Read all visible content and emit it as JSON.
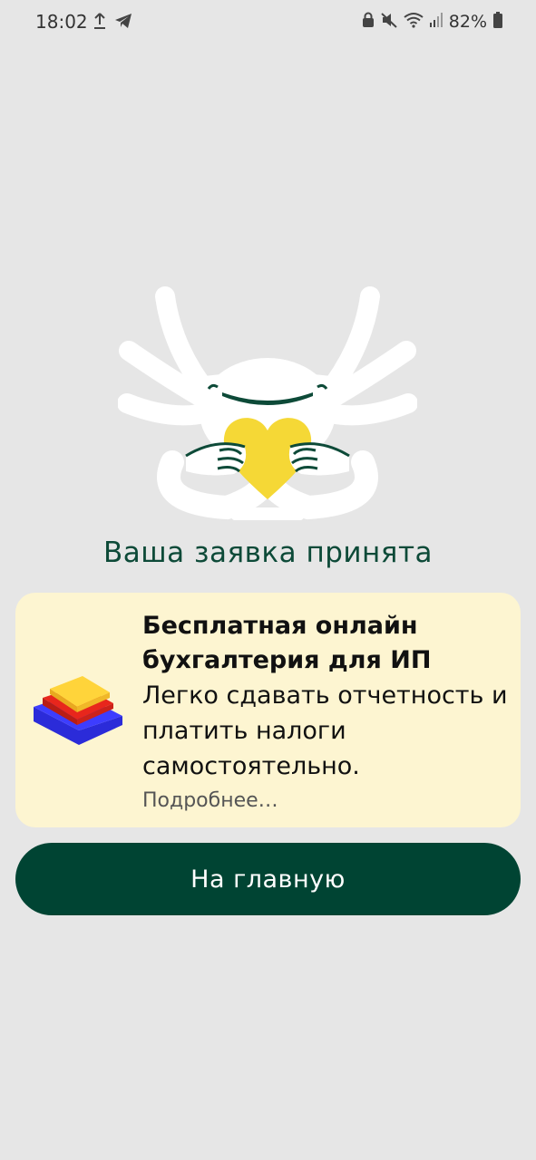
{
  "status_bar": {
    "time": "18:02",
    "battery_percent": "82%",
    "icons": [
      "upload-icon",
      "telegram-icon",
      "lock-icon",
      "mute-icon",
      "wifi-icon",
      "signal-icon",
      "battery-icon"
    ]
  },
  "illustration": {
    "icon": "heart-mascot-illustration",
    "colors": {
      "body": "#ffffff",
      "heart": "#f5d836",
      "accent": "#0d4a38"
    }
  },
  "page": {
    "title": "Ваша заявка принята"
  },
  "promo": {
    "title": "Бесплатная онлайн бухгалтерия для ИП",
    "description": "Легко сдавать отчетность и платить налоги самостоятельно.",
    "link": "Подробнее…",
    "icon": "stacked-layers-icon"
  },
  "actions": {
    "home_label": "На главную"
  },
  "colors": {
    "brand": "#004433",
    "card_bg": "#fdf5d1",
    "page_bg": "#e6e6e6"
  }
}
